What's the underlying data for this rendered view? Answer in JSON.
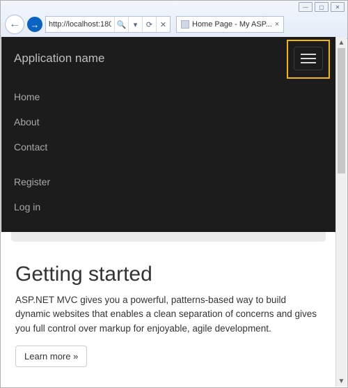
{
  "window_controls": {
    "min": "—",
    "max": "▢",
    "close": "✕"
  },
  "browser": {
    "back_glyph": "←",
    "forward_glyph": "→",
    "url": "http://localhost:180",
    "search_glyph": "🔍",
    "arrow_glyph": "▾",
    "refresh_glyph": "⟳",
    "stop_glyph": "✕",
    "tab_title": "Home Page - My ASP...",
    "tab_close": "×"
  },
  "navbar": {
    "brand": "Application name",
    "items": [
      {
        "label": "Home"
      },
      {
        "label": "About"
      },
      {
        "label": "Contact"
      }
    ],
    "auth_items": [
      {
        "label": "Register"
      },
      {
        "label": "Log in"
      }
    ]
  },
  "content": {
    "heading": "Getting started",
    "paragraph": "ASP.NET MVC gives you a powerful, patterns-based way to build dynamic websites that enables a clean separation of concerns and gives you full control over markup for enjoyable, agile development.",
    "learn_more": "Learn more »"
  },
  "scrollbar": {
    "up": "▲",
    "down": "▼"
  }
}
